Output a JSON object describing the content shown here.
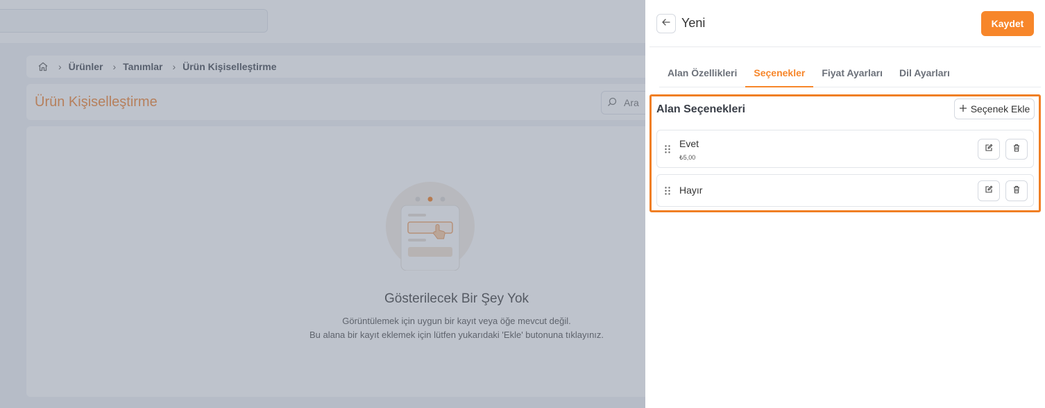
{
  "background": {
    "breadcrumb": [
      "Ürünler",
      "Tanımlar",
      "Ürün Kişiselleştirme"
    ],
    "page_title": "Ürün Kişiselleştirme",
    "search_placeholder": "Ara",
    "empty_state": {
      "title": "Gösterilecek Bir Şey Yok",
      "line1": "Görüntülemek için uygun bir kayıt veya öğe mevcut değil.",
      "line2": "Bu alana bir kayıt eklemek için lütfen yukarıdaki 'Ekle' butonuna tıklayınız."
    }
  },
  "drawer": {
    "title": "Yeni",
    "save_label": "Kaydet",
    "tabs": [
      {
        "label": "Alan Özellikleri",
        "active": false
      },
      {
        "label": "Seçenekler",
        "active": true
      },
      {
        "label": "Fiyat Ayarları",
        "active": false
      },
      {
        "label": "Dil Ayarları",
        "active": false
      }
    ],
    "section_title": "Alan Seçenekleri",
    "add_option_label": "Seçenek Ekle",
    "options": [
      {
        "name": "Evet",
        "price": "₺5,00"
      },
      {
        "name": "Hayır"
      }
    ]
  },
  "colors": {
    "accent": "#f7862a",
    "highlight_border": "#f07f24",
    "overlay": "rgba(108,118,138,0.44)"
  },
  "icons": [
    "home-icon",
    "chevron-right-icon",
    "search-icon",
    "arrow-left-icon",
    "plus-icon",
    "drag-handle-icon",
    "edit-icon",
    "trash-icon"
  ]
}
